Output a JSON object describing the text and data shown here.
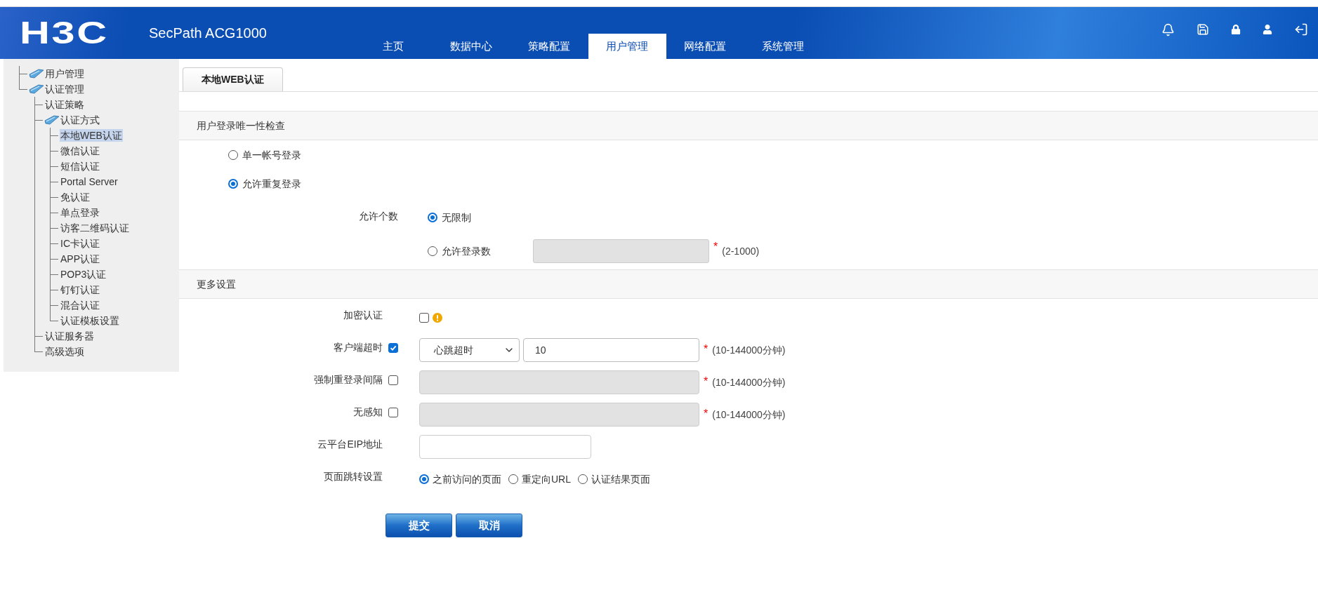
{
  "header": {
    "logo": "H3C",
    "product": "SecPath ACG1000",
    "nav": [
      {
        "label": "主页",
        "selected": false
      },
      {
        "label": "数据中心",
        "selected": false
      },
      {
        "label": "策略配置",
        "selected": false
      },
      {
        "label": "用户管理",
        "selected": true
      },
      {
        "label": "网络配置",
        "selected": false
      },
      {
        "label": "系统管理",
        "selected": false
      }
    ]
  },
  "sidebar": {
    "tree": [
      {
        "label": "用户管理",
        "selected": false,
        "kind": "folder"
      },
      {
        "label": "认证管理",
        "selected": false,
        "kind": "folder",
        "children": [
          {
            "label": "认证策略",
            "selected": false
          },
          {
            "label": "认证方式",
            "selected": false,
            "kind": "folder",
            "children": [
              {
                "label": "本地WEB认证",
                "selected": true
              },
              {
                "label": "微信认证",
                "selected": false
              },
              {
                "label": "短信认证",
                "selected": false
              },
              {
                "label": "Portal Server",
                "selected": false
              },
              {
                "label": "免认证",
                "selected": false
              },
              {
                "label": "单点登录",
                "selected": false
              },
              {
                "label": "访客二维码认证",
                "selected": false
              },
              {
                "label": "IC卡认证",
                "selected": false
              },
              {
                "label": "APP认证",
                "selected": false
              },
              {
                "label": "POP3认证",
                "selected": false
              },
              {
                "label": "钉钉认证",
                "selected": false
              },
              {
                "label": "混合认证",
                "selected": false
              },
              {
                "label": "认证模板设置",
                "selected": false
              }
            ]
          },
          {
            "label": "认证服务器",
            "selected": false
          },
          {
            "label": "高级选项",
            "selected": false
          }
        ]
      }
    ]
  },
  "tabs": [
    {
      "label": "本地WEB认证",
      "selected": true
    }
  ],
  "uniqueness": {
    "title": "用户登录唯一性检查",
    "options": [
      {
        "label": "单一帐号登录",
        "selected": false
      },
      {
        "label": "允许重复登录",
        "selected": true
      }
    ],
    "count": {
      "label": "允许个数",
      "options": [
        {
          "label": "无限制",
          "selected": true
        },
        {
          "label": "允许登录数",
          "selected": false,
          "mark": "*",
          "hint": "(2-1000)"
        }
      ]
    }
  },
  "more": {
    "title": "更多设置",
    "rows": [
      {
        "kind": "checkbox",
        "label": "加密认证",
        "checked": false
      },
      {
        "kind": "timeout",
        "label": "客户端超时",
        "checked": true,
        "select": "心跳超时",
        "value": "10",
        "mark": "*",
        "hint": "(10-144000分钟)"
      },
      {
        "kind": "timeout",
        "label": "强制重登录间隔",
        "checked": false,
        "mark": "*",
        "hint": "(10-144000分钟)"
      },
      {
        "kind": "timeout",
        "label": "无感知",
        "checked": false,
        "mark": "*",
        "hint": "(10-144000分钟)"
      },
      {
        "kind": "text",
        "label": "云平台EIP地址"
      },
      {
        "kind": "radios",
        "label": "页面跳转设置",
        "options": [
          {
            "label": "之前访问的页面",
            "selected": true
          },
          {
            "label": "重定向URL",
            "selected": false
          },
          {
            "label": "认证结果页面",
            "selected": false
          }
        ]
      }
    ]
  },
  "buttons": [
    "提交",
    "取消"
  ]
}
